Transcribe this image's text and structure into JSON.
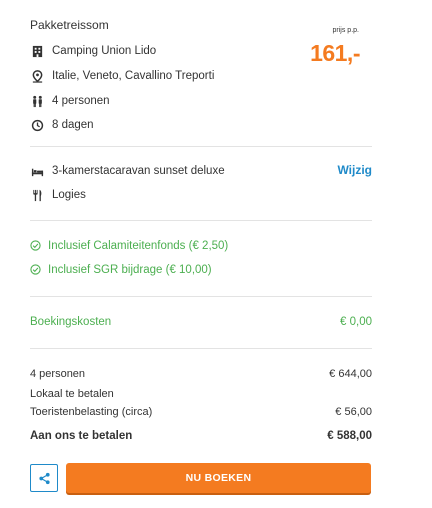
{
  "header": {
    "title": "Pakketreissom",
    "price_label": "prijs p.p.",
    "price": "161,-"
  },
  "details": [
    {
      "icon": "building-icon",
      "text": "Camping Union Lido"
    },
    {
      "icon": "location-pin-icon",
      "text": "Italie, Veneto, Cavallino Treporti"
    },
    {
      "icon": "persons-icon",
      "text": "4 personen"
    },
    {
      "icon": "clock-icon",
      "text": "8 dagen"
    }
  ],
  "accommodation": {
    "type": "3-kamerstacaravan sunset deluxe",
    "board": "Logies",
    "change_label": "Wijzig"
  },
  "inclusions": [
    "Inclusief Calamiteitenfonds (€ 2,50)",
    "Inclusief SGR bijdrage (€ 10,00)"
  ],
  "booking_fee": {
    "label": "Boekingskosten",
    "value": "€ 0,00"
  },
  "summary": {
    "persons_label": "4 personen",
    "persons_value": "€ 644,00",
    "local_label": "Lokaal te betalen",
    "tax_label": "Toeristenbelasting (circa)",
    "tax_value": "€ 56,00",
    "total_label": "Aan ons te betalen",
    "total_value": "€ 588,00"
  },
  "actions": {
    "share_icon": "share-icon",
    "book_label": "NU BOEKEN"
  },
  "colors": {
    "accent": "#f47b20",
    "link": "#1f8ac9",
    "success": "#4caf50"
  }
}
